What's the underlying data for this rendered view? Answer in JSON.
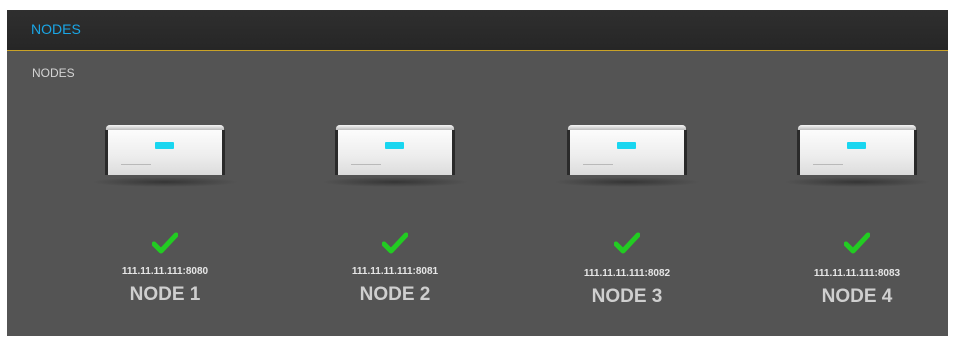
{
  "header": {
    "title": "NODES"
  },
  "section": {
    "label": "NODES"
  },
  "nodes": [
    {
      "address": "111.11.11.111:8080",
      "name": "NODE 1",
      "status": "ok",
      "status_icon": "check-icon"
    },
    {
      "address": "111.11.11.111:8081",
      "name": "NODE 2",
      "status": "ok",
      "status_icon": "check-icon"
    },
    {
      "address": "111.11.11.111:8082",
      "name": "NODE 3",
      "status": "ok",
      "status_icon": "check-icon"
    },
    {
      "address": "111.11.11.111:8083",
      "name": "NODE 4",
      "status": "ok",
      "status_icon": "check-icon"
    }
  ],
  "colors": {
    "accent": "#1aa6e6",
    "header_border": "#c9a227",
    "status_ok": "#22cc22",
    "device_logo": "#19d6f0"
  }
}
